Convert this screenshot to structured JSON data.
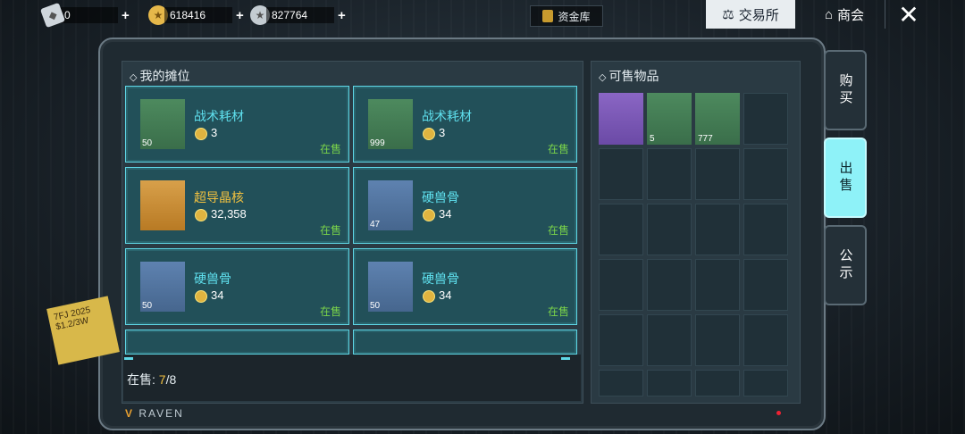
{
  "topbar": {
    "currencies": [
      {
        "icon": "ticket-icon",
        "value": "0"
      },
      {
        "icon": "gold-coin-icon",
        "value": "618416"
      },
      {
        "icon": "silver-coin-icon",
        "value": "827764"
      }
    ],
    "plus": "+",
    "vault_label": "资金库",
    "trade_label": "交易所",
    "shop_label": "商会",
    "close_glyph": "✕"
  },
  "my_stall": {
    "title": "我的摊位",
    "slots": [
      {
        "name": "战术耗材",
        "count": "50",
        "price": "3",
        "status": "在售",
        "rarity": "green"
      },
      {
        "name": "战术耗材",
        "count": "999",
        "price": "3",
        "status": "在售",
        "rarity": "green"
      },
      {
        "name": "超导晶核",
        "count": "",
        "price": "32,358",
        "status": "在售",
        "rarity": "gold"
      },
      {
        "name": "硬兽骨",
        "count": "47",
        "price": "34",
        "status": "在售",
        "rarity": "blue"
      },
      {
        "name": "硬兽骨",
        "count": "50",
        "price": "34",
        "status": "在售",
        "rarity": "blue"
      },
      {
        "name": "硬兽骨",
        "count": "50",
        "price": "34",
        "status": "在售",
        "rarity": "blue"
      }
    ],
    "footer_label": "在售:",
    "on_sale_count": "7",
    "on_sale_max": "/8"
  },
  "sellable": {
    "title": "可售物品",
    "items": [
      {
        "icon": "bread-icon",
        "count": "",
        "rarity": "purple"
      },
      {
        "icon": "medkit-icon",
        "count": "5",
        "rarity": "green"
      },
      {
        "icon": "battery-crate-icon",
        "count": "777",
        "rarity": "green"
      }
    ]
  },
  "side_tabs": [
    {
      "label": "购买",
      "active": false
    },
    {
      "label": "出售",
      "active": true
    },
    {
      "label": "公示",
      "active": false
    }
  ],
  "brand": "RAVEN",
  "note_text": "7FJ 2025 $1.2/3W"
}
